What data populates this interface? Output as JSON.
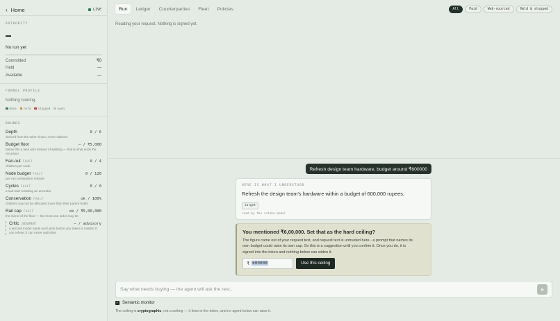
{
  "sidebar": {
    "home_label": "Home",
    "live_label": "LIVE",
    "authority": {
      "heading": "AUTHORITY",
      "status": "No run yet",
      "committed_label": "Committed",
      "committed_value": "₹0",
      "held_label": "Held",
      "held_value": "—",
      "available_label": "Available",
      "available_value": "—"
    },
    "funnel": {
      "heading": "FUNNEL PROFILE",
      "status": "Nothing running.",
      "legend": [
        {
          "label": "done",
          "color": "#2f7a50"
        },
        {
          "label": "held",
          "color": "#c98a2a"
        },
        {
          "label": "stopped",
          "color": "#c0443a"
        },
        {
          "label": "open",
          "color": "#b9c2b9"
        }
      ]
    },
    "bounds": {
      "heading": "BOUNDS",
      "items": [
        {
          "label": "Depth",
          "tag": "",
          "value": "0 / 6",
          "desc": "derived from the token chain, never claimed"
        },
        {
          "label": "Budget floor",
          "tag": "",
          "value": "— / ₹5,000",
          "desc": "below this a task acts instead of splitting — this is what ends the recursion"
        },
        {
          "label": "Fan-out",
          "tag": "FAULT",
          "value": "0 / 4",
          "desc": "children per node"
        },
        {
          "label": "Node budget",
          "tag": "FAULT",
          "value": "0 / 120",
          "desc": "per run; exhaustion refuses"
        },
        {
          "label": "Cycles",
          "tag": "FAULT",
          "value": "0 / 0",
          "desc": "a sub-task restating an ancestor"
        },
        {
          "label": "Conservation",
          "tag": "FAULT",
          "value": "ok / 100%",
          "desc": "children may not be allocated more than their parent holds"
        },
        {
          "label": "Rail cap",
          "tag": "FAULT",
          "value": "ok / ₹5,00,000",
          "desc": "the mirror of the floor — the most one order may be"
        }
      ],
      "critic": {
        "label": "Critic",
        "tag": "JUDGEMENT",
        "value": "— / advisory",
        "desc": "a second model reads each plan before any token is minted. It can refuse; it can never authorise"
      }
    }
  },
  "main": {
    "tabs": [
      "Run",
      "Ledger",
      "Counterparties",
      "Fleet",
      "Policies"
    ],
    "active_tab": "Run",
    "filters": [
      "All",
      "Paid",
      "Web-sourced",
      "Held & stopped"
    ],
    "status_line": "Reading your request. Nothing is signed yet.",
    "user_message": "Refresh design team hardware, budget around ₹600000",
    "understood": {
      "label": "HERE IS WHAT I UNDERSTOOD",
      "text": "Refresh the design team's hardware within a budget of 600,000 rupees.",
      "tag": "target",
      "read_by": "read by the intake model"
    },
    "ceiling": {
      "question": "You mentioned ₹6,00,000. Set that as the hard ceiling?",
      "explanation": "The figure came out of your request text, and request text is untrusted here - a prompt that names its own budget could raise its own cap. So this is a suggestion until you confirm it. Once you do, it is signed into the token and nothing below can widen it.",
      "currency": "₹",
      "amount": "600000",
      "button": "Use this ceiling"
    },
    "composer_placeholder": "Say what needs buying — the agent will ask the rest...",
    "monitor_label": "Semantic monitor",
    "note_prefix": "The ceiling is ",
    "note_bold": "cryptographic",
    "note_suffix": ", not a setting — it lives in the token, and no agent below can raise it."
  }
}
